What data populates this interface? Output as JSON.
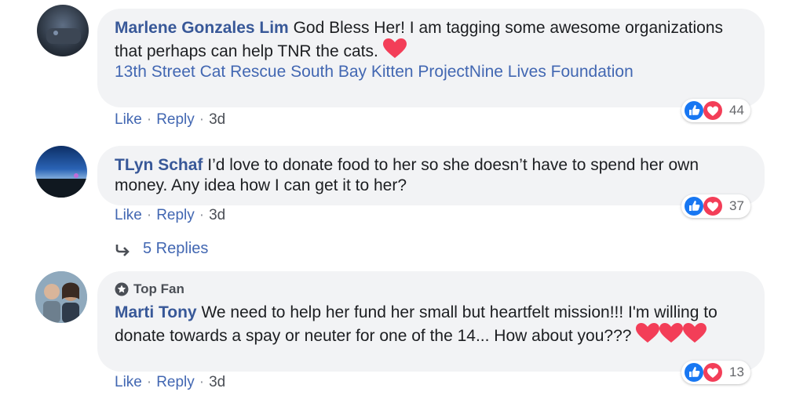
{
  "comments": [
    {
      "author": "Marlene Gonzales Lim",
      "text": "God Bless Her! I am tagging some awesome organizations that perhaps can help TNR the cats.",
      "tags": [
        "13th Street Cat Rescue",
        "South Bay Kitten Project",
        "Nine Lives Foundation"
      ],
      "actions": {
        "like": "Like",
        "reply": "Reply",
        "time": "3d"
      },
      "reaction_count": "44"
    },
    {
      "author": "TLyn Schaf",
      "text": "I’d love to donate food to her so she doesn’t have to spend her own money. Any idea how I can get it to her?",
      "actions": {
        "like": "Like",
        "reply": "Reply",
        "time": "3d"
      },
      "reaction_count": "37",
      "replies_label": "5 Replies"
    },
    {
      "badge": "Top Fan",
      "author": "Marti Tony",
      "text": "We need to help her fund her small but heartfelt mission!!! I'm willing to donate towards a spay or neuter for one of the 14... How about you???",
      "actions": {
        "like": "Like",
        "reply": "Reply",
        "time": "3d"
      },
      "reaction_count": "13"
    }
  ],
  "colors": {
    "author": "#385898",
    "link": "#4267b2",
    "bubble": "#f2f3f5",
    "heart": "#f33e58",
    "like": "#1877f2"
  }
}
